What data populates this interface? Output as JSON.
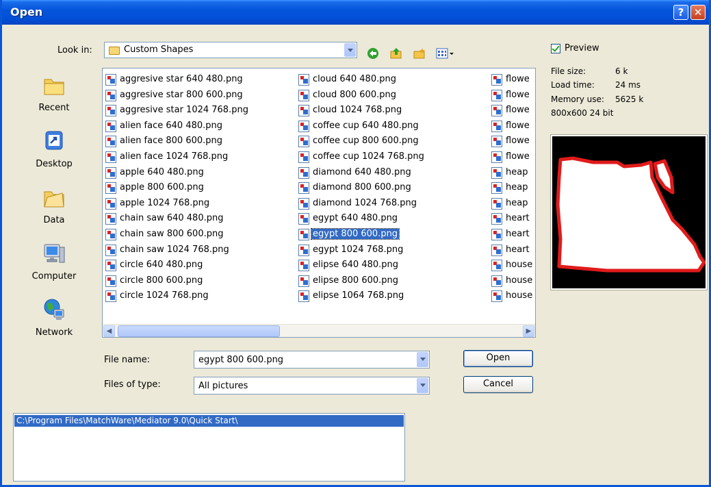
{
  "window": {
    "title": "Open",
    "help_label": "?",
    "close_label": "✕"
  },
  "look_in": {
    "label": "Look in:",
    "value": "Custom Shapes"
  },
  "toolbar_icons": [
    "back-icon",
    "up-folder-icon",
    "new-folder-icon",
    "view-menu-icon"
  ],
  "places": [
    {
      "label": "Recent",
      "icon": "recent-folder-icon"
    },
    {
      "label": "Desktop",
      "icon": "desktop-icon"
    },
    {
      "label": "Data",
      "icon": "data-folder-icon"
    },
    {
      "label": "Computer",
      "icon": "computer-icon"
    },
    {
      "label": "Network",
      "icon": "network-icon"
    }
  ],
  "files": {
    "col1": [
      "aggresive star 640 480.png",
      "aggresive star 800 600.png",
      "aggresive star 1024 768.png",
      "alien face 640 480.png",
      "alien face 800 600.png",
      "alien face 1024 768.png",
      "apple 640 480.png",
      "apple 800 600.png",
      "apple 1024 768.png",
      "chain saw 640 480.png",
      "chain saw 800 600.png",
      "chain saw 1024 768.png",
      "circle 640 480.png",
      "circle 800 600.png",
      "circle 1024 768.png"
    ],
    "col2": [
      "cloud 640 480.png",
      "cloud 800 600.png",
      "cloud 1024 768.png",
      "coffee cup 640 480.png",
      "coffee cup 800 600.png",
      "coffee cup 1024 768.png",
      "diamond 640 480.png",
      "diamond 800 600.png",
      "diamond 1024 768.png",
      "egypt 640 480.png",
      "egypt 800 600.png",
      "egypt 1024 768.png",
      "elipse 640 480.png",
      "elipse 800 600.png",
      "elipse 1064 768.png"
    ],
    "col3": [
      "flowe",
      "flowe",
      "flowe",
      "flowe",
      "flowe",
      "flowe",
      "heap",
      "heap",
      "heap",
      "heart",
      "heart",
      "heart",
      "house",
      "house",
      "house"
    ],
    "selected": "egypt 800 600.png"
  },
  "file_name": {
    "label": "File name:",
    "value": "egypt 800 600.png"
  },
  "file_type": {
    "label": "Files of type:",
    "value": "All pictures"
  },
  "buttons": {
    "open": "Open",
    "cancel": "Cancel"
  },
  "preview": {
    "checkbox_label": "Preview",
    "checked": true,
    "file_size_label": "File size:",
    "file_size_value": "6 k",
    "load_time_label": "Load time:",
    "load_time_value": "24 ms",
    "memory_label": "Memory use:",
    "memory_value": "5625 k",
    "dimensions": "800x600 24 bit"
  },
  "path_list": {
    "selected": "C:\\Program Files\\MatchWare\\Mediator 9.0\\Quick Start\\"
  },
  "colors": {
    "title_bar": "#0455DB",
    "selection": "#316AC5",
    "dialog_bg": "#ECE9D8",
    "shape_outline": "#E11B1B"
  }
}
